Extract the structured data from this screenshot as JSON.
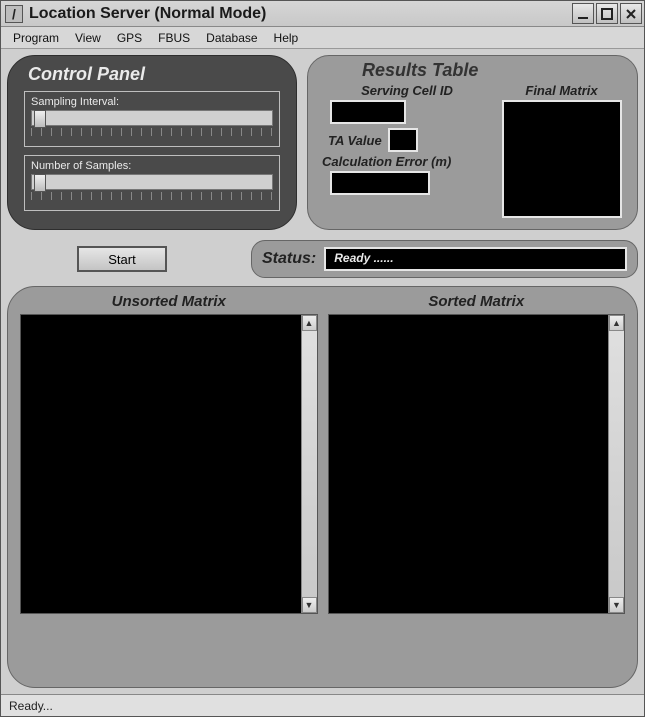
{
  "window": {
    "title": "Location Server (Normal Mode)"
  },
  "menu": {
    "program": "Program",
    "view": "View",
    "gps": "GPS",
    "fbus": "FBUS",
    "database": "Database",
    "help": "Help"
  },
  "control_panel": {
    "title": "Control Panel",
    "sampling_label": "Sampling Interval:",
    "samples_label": "Number of Samples:"
  },
  "results": {
    "title": "Results Table",
    "serving_cell_label": "Serving Cell ID",
    "ta_label": "TA Value",
    "calc_error_label": "Calculation Error (m)",
    "final_matrix_label": "Final Matrix"
  },
  "actions": {
    "start": "Start"
  },
  "status": {
    "label": "Status:",
    "value": "Ready ......"
  },
  "matrices": {
    "unsorted_label": "Unsorted Matrix",
    "sorted_label": "Sorted Matrix"
  },
  "statusbar": {
    "text": "Ready..."
  }
}
